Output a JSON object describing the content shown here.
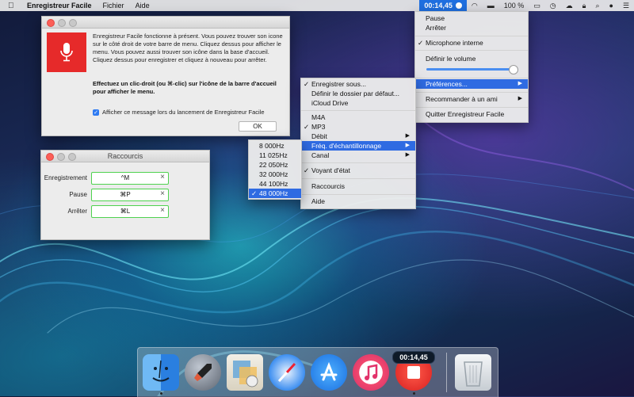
{
  "menubar": {
    "app_name": "Enregistreur Facile",
    "items": [
      "Fichier",
      "Aide"
    ],
    "timer": "00:14,45",
    "battery": "100 %"
  },
  "notice_window": {
    "message": "Enregistreur Facile fonctionne à présent. Vous pouvez trouver son icone sur le côté droit de votre barre de menu. Cliquez dessus pour afficher le menu. Vous pouvez aussi trouver son icône dans la base d'accueil. Cliquez dessus pour enregistrer et cliquez à nouveau pour arrêter.",
    "bold_message": "Effectuez un clic-droit (ou ⌘-clic) sur l'icône de la barre d'accueil pour afficher le menu.",
    "checkbox_label": "Afficher ce message lors du lancement de Enregistreur Facile",
    "ok_label": "OK"
  },
  "shortcuts_window": {
    "title": "Raccourcis",
    "rows": [
      {
        "label": "Enregistrement",
        "key": "^M"
      },
      {
        "label": "Pause",
        "key": "⌘P"
      },
      {
        "label": "Arrêter",
        "key": "⌘L"
      }
    ]
  },
  "status_menu": {
    "pause": "Pause",
    "stop": "Arrêter",
    "microphone": "Microphone interne",
    "volume": "Définir le volume",
    "volume_level": 0.95,
    "preferences": "Préférences...",
    "recommend": "Recommander à un ami",
    "quit": "Quitter Enregistreur Facile"
  },
  "prefs_menu": {
    "save_to": "Enregistrer sous...",
    "default_folder": "Définir le dossier par défaut...",
    "icloud": "iCloud Drive",
    "m4a": "M4A",
    "mp3": "MP3",
    "bitrate": "Débit",
    "sample_rate": "Fréq. d'échantillonnage",
    "channel": "Canal",
    "status_light": "Voyant d'état",
    "shortcuts": "Raccourcis",
    "help": "Aide"
  },
  "freq_menu": {
    "items": [
      "8 000Hz",
      "11 025Hz",
      "22 050Hz",
      "32 000Hz",
      "44 100Hz",
      "48 000Hz"
    ],
    "selected": "48 000Hz"
  },
  "dock": {
    "rec_timer": "00:14,45",
    "apps": [
      "finder-icon",
      "launchpad-icon",
      "preview-icon",
      "safari-icon",
      "app-store-icon",
      "itunes-icon",
      "recorder-icon",
      "trash-icon"
    ]
  }
}
